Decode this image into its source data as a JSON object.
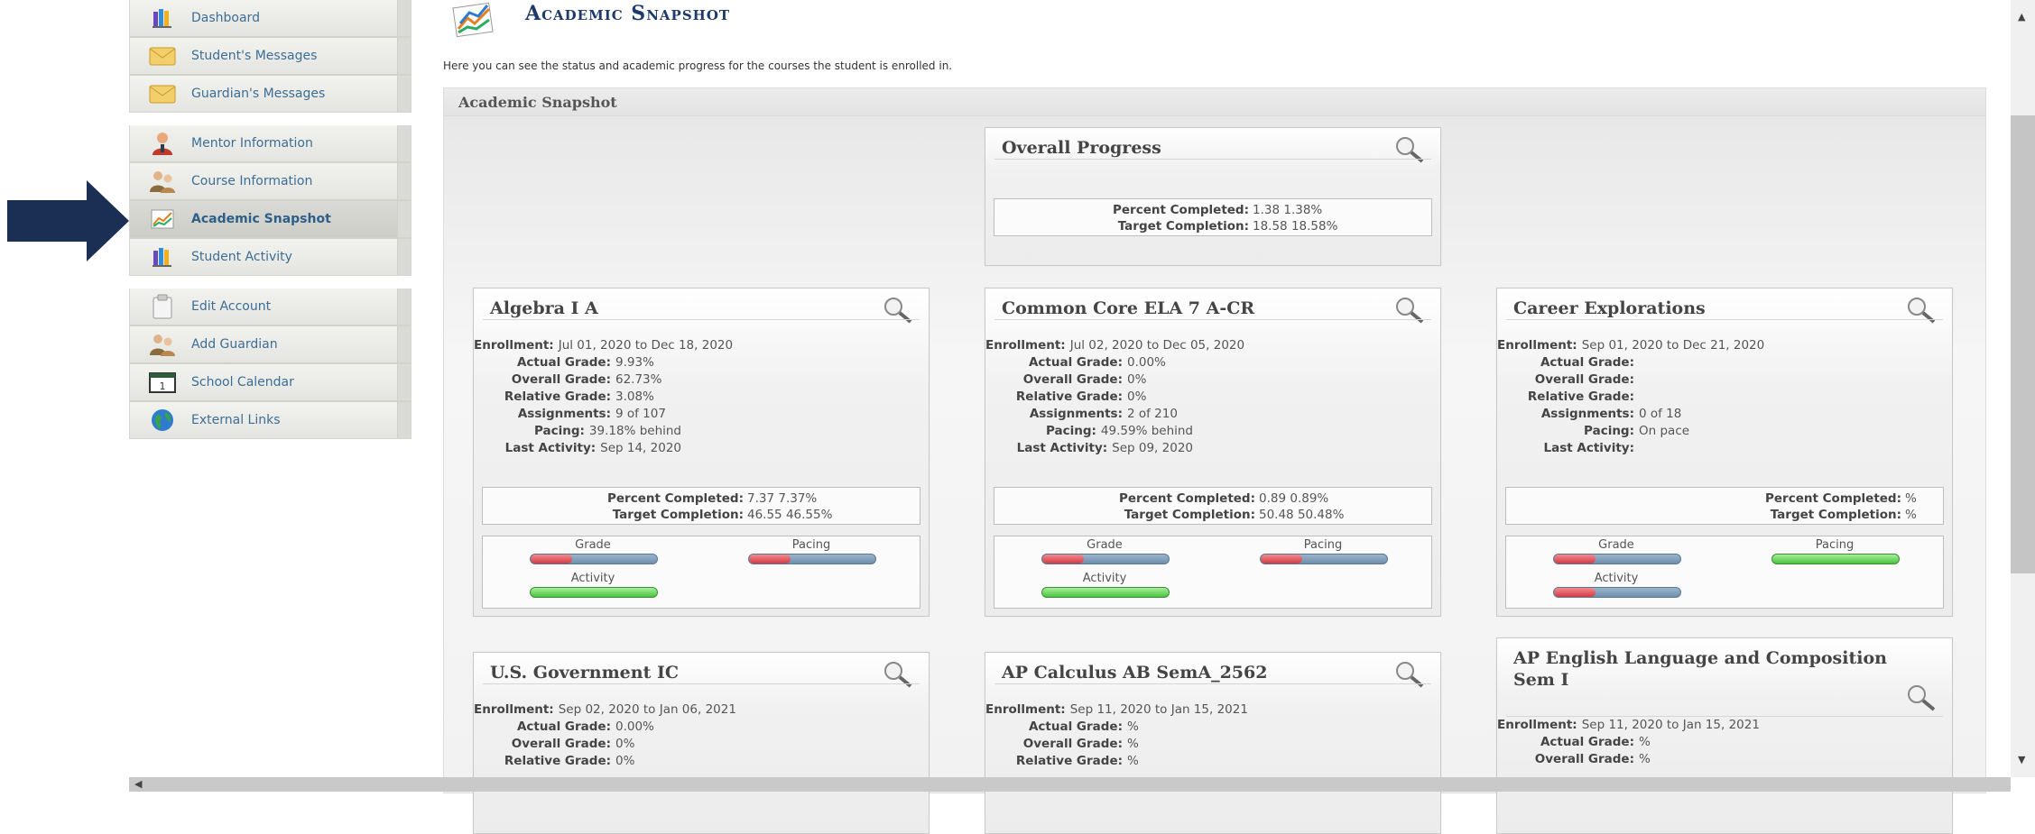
{
  "sidebar": {
    "groups": [
      [
        {
          "label": "Dashboard",
          "icon": "books-icon"
        },
        {
          "label": "Student's Messages",
          "icon": "envelope-icon"
        },
        {
          "label": "Guardian's Messages",
          "icon": "envelope-icon"
        }
      ],
      [
        {
          "label": "Mentor Information",
          "icon": "mentor-icon"
        },
        {
          "label": "Course Information",
          "icon": "people-icon"
        },
        {
          "label": "Academic Snapshot",
          "icon": "chart-icon",
          "active": true
        },
        {
          "label": "Student Activity",
          "icon": "books-icon"
        }
      ],
      [
        {
          "label": "Edit Account",
          "icon": "clipboard-icon"
        },
        {
          "label": "Add Guardian",
          "icon": "people-icon"
        },
        {
          "label": "School Calendar",
          "icon": "calendar-icon"
        },
        {
          "label": "External Links",
          "icon": "globe-icon"
        }
      ]
    ]
  },
  "header": {
    "title": "Academic Snapshot",
    "intro": "Here you can see the status and academic progress for the courses the student is enrolled in."
  },
  "panel": {
    "title": "Academic Snapshot"
  },
  "overall": {
    "title": "Overall Progress",
    "percent_label": "Percent Completed:",
    "percent_value": "1.38  1.38%",
    "target_label": "Target Completion:",
    "target_value": "18.58  18.58%"
  },
  "labels": {
    "enrollment": "Enrollment:",
    "actual": "Actual Grade:",
    "overall": "Overall Grade:",
    "relative": "Relative Grade:",
    "assignments": "Assignments:",
    "pacing": "Pacing:",
    "last": "Last Activity:",
    "percent": "Percent Completed:",
    "target": "Target Completion:",
    "meter_grade": "Grade",
    "meter_pacing": "Pacing",
    "meter_activity": "Activity"
  },
  "courses": [
    {
      "title": "Algebra I A",
      "enrollment": "Jul 01, 2020 to Dec 18, 2020",
      "actual": "9.93%",
      "overall": "62.73%",
      "relative": "3.08%",
      "assignments": "9 of 107",
      "pacing": "39.18% behind",
      "last": "Sep 14, 2020",
      "percent": "7.37  7.37%",
      "target": "46.55  46.55%",
      "grade_level": 0.33,
      "pacing_level": 0.33,
      "activity_level": 1.0,
      "grade_green": false,
      "pacing_green": false,
      "activity_green": true
    },
    {
      "title": "Common Core ELA 7 A-CR",
      "enrollment": "Jul 02, 2020 to Dec 05, 2020",
      "actual": "0.00%",
      "overall": "0%",
      "relative": "0%",
      "assignments": "2 of 210",
      "pacing": "49.59% behind",
      "last": "Sep 09, 2020",
      "percent": "0.89  0.89%",
      "target": "50.48  50.48%",
      "grade_level": 0.33,
      "pacing_level": 0.33,
      "activity_level": 1.0,
      "grade_green": false,
      "pacing_green": false,
      "activity_green": true
    },
    {
      "title": "Career Explorations",
      "enrollment": "Sep 01, 2020 to Dec 21, 2020",
      "actual": "",
      "overall": "",
      "relative": "",
      "assignments": "0 of 18",
      "pacing": "On pace",
      "last": "",
      "percent": " %",
      "target": " %",
      "grade_level": 0.33,
      "pacing_level": 1.0,
      "activity_level": 0.33,
      "grade_green": false,
      "pacing_green": true,
      "activity_green": false
    },
    {
      "title": "U.S. Government IC",
      "enrollment": "Sep 02, 2020 to Jan 06, 2021",
      "actual": "0.00%",
      "overall": "0%",
      "relative": "0%"
    },
    {
      "title": "AP Calculus AB SemA_2562",
      "enrollment": "Sep 11, 2020 to Jan 15, 2021",
      "actual": "%",
      "overall": "%",
      "relative": "%"
    },
    {
      "title": "AP English Language and Composition Sem I",
      "enrollment": "Sep 11, 2020 to Jan 15, 2021",
      "actual": "%",
      "overall": "%"
    }
  ],
  "colors": {
    "title": "#1e3a6a",
    "link": "#3c6e96",
    "arrow": "#1b2f55",
    "bar_red": "#d23a43",
    "bar_blue": "#6f8fae",
    "bar_green": "#4ac440"
  }
}
